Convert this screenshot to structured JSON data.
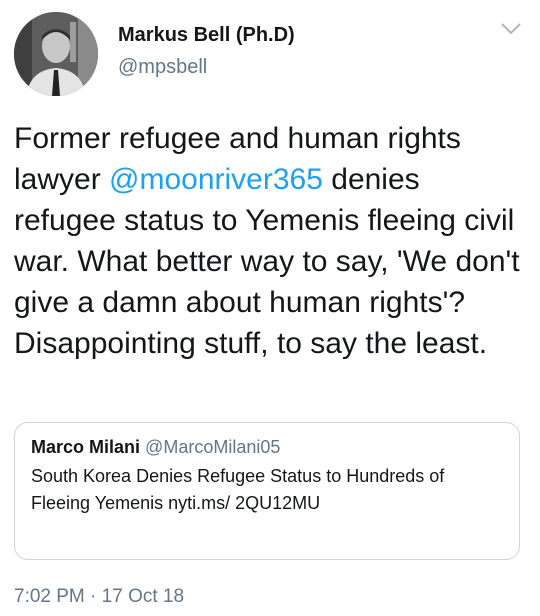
{
  "author": {
    "display_name": "Markus Bell (Ph.D)",
    "handle": "@mpsbell",
    "avatar_icon": "profile-photo"
  },
  "tweet": {
    "text_before_mention": "Former refugee and human rights lawyer ",
    "mention": "@moonriver365",
    "text_after_mention": " denies refugee status to Yemenis fleeing civil war. What better way to say, 'We don't give a damn about human rights'? Disappointing stuff, to say the least."
  },
  "quoted_tweet": {
    "display_name": "Marco Milani",
    "handle": "@MarcoMilani05",
    "text": "South Korea Denies Refugee Status to Hundreds of Fleeing Yemenis nyti.ms/ 2QU12MU"
  },
  "meta": {
    "time": "7:02 PM",
    "separator": " · ",
    "date": "17 Oct 18"
  },
  "menu_icon": "chevron-down-icon",
  "colors": {
    "mention": "#1da1f2",
    "secondary_text": "#657786",
    "border": "#ccd6dd"
  }
}
